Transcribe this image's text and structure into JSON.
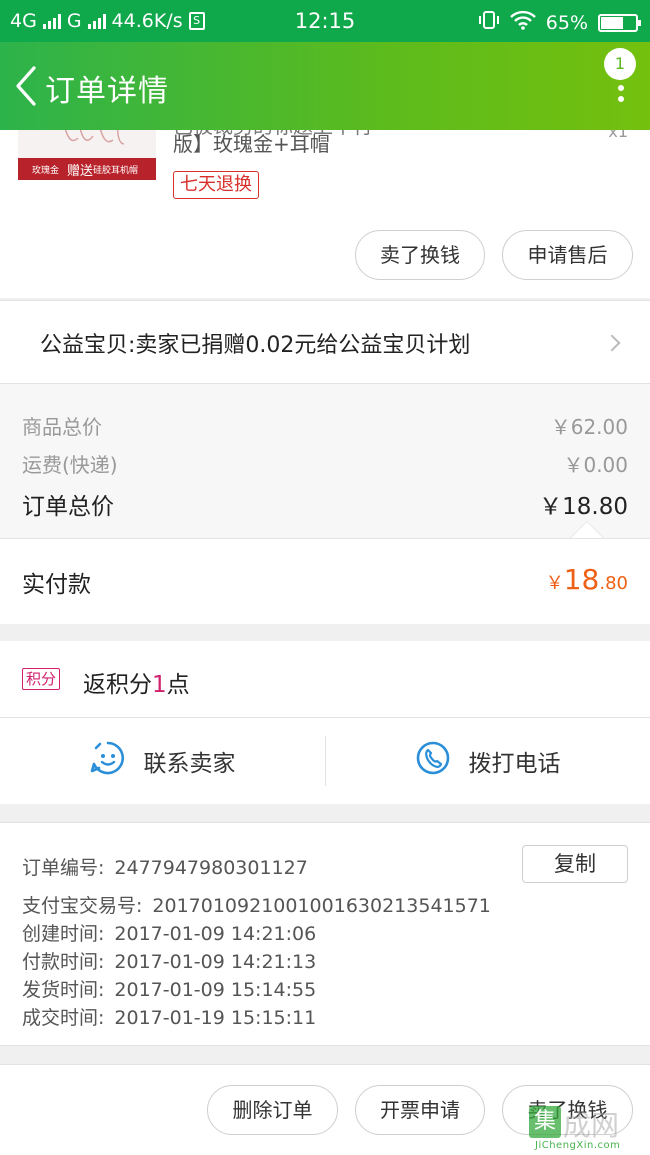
{
  "statusbar": {
    "net1": "4G",
    "net2": "G",
    "speed": "44.6K/s",
    "time": "12:15",
    "battery": "65%",
    "battery_level": 0.65
  },
  "header": {
    "title": "订单详情",
    "badge": "1"
  },
  "product": {
    "name_cut": "已被裁剪的标题上半行",
    "name_line2": "版】玫瑰金+耳帽",
    "qty": "x1",
    "tag": "七天退换",
    "thumb_label1": "玫瑰金",
    "thumb_label2": "赠送",
    "thumb_label3": "硅胶耳机帽",
    "btn_sell": "卖了换钱",
    "btn_aftersale": "申请售后"
  },
  "charity": {
    "text": "公益宝贝:卖家已捐赠0.02元给公益宝贝计划"
  },
  "prices": {
    "goods_label": "商品总价",
    "goods_value": "￥62.00",
    "shipping_label": "运费(快递)",
    "shipping_value": "￥0.00",
    "total_label": "订单总价",
    "total_value": "￥18.80",
    "paid_label": "实付款",
    "paid_symbol": "￥",
    "paid_int": "18",
    "paid_dec": ".80"
  },
  "points": {
    "tag": "积分",
    "prefix": "返积分",
    "num": "1",
    "suffix": "点"
  },
  "contact": {
    "seller": "联系卖家",
    "call": "拨打电话"
  },
  "info": {
    "order_no_label": "订单编号:",
    "order_no": "2477947980301127",
    "copy": "复制",
    "alipay_label": "支付宝交易号:",
    "alipay": "20170109210010016302135415​71",
    "created_label": "创建时间:",
    "created": "2017-01-09 14:21:06",
    "paid_label": "付款时间:",
    "paid": "2017-01-09 14:21:13",
    "shipped_label": "发货时间:",
    "shipped": "2017-01-09 15:14:55",
    "done_label": "成交时间:",
    "done": "2017-01-19 15:15:11"
  },
  "footer": {
    "delete": "删除订单",
    "invoice": "开票申请",
    "sell": "卖了换钱"
  },
  "watermark": {
    "box": "集",
    "big": "成网",
    "small": "JiChengXin.com"
  },
  "colors": {
    "green": "#0fa84b",
    "orange": "#ee6016",
    "red": "#d9302c",
    "magenta": "#d0206e",
    "blue": "#2a8fd8"
  }
}
